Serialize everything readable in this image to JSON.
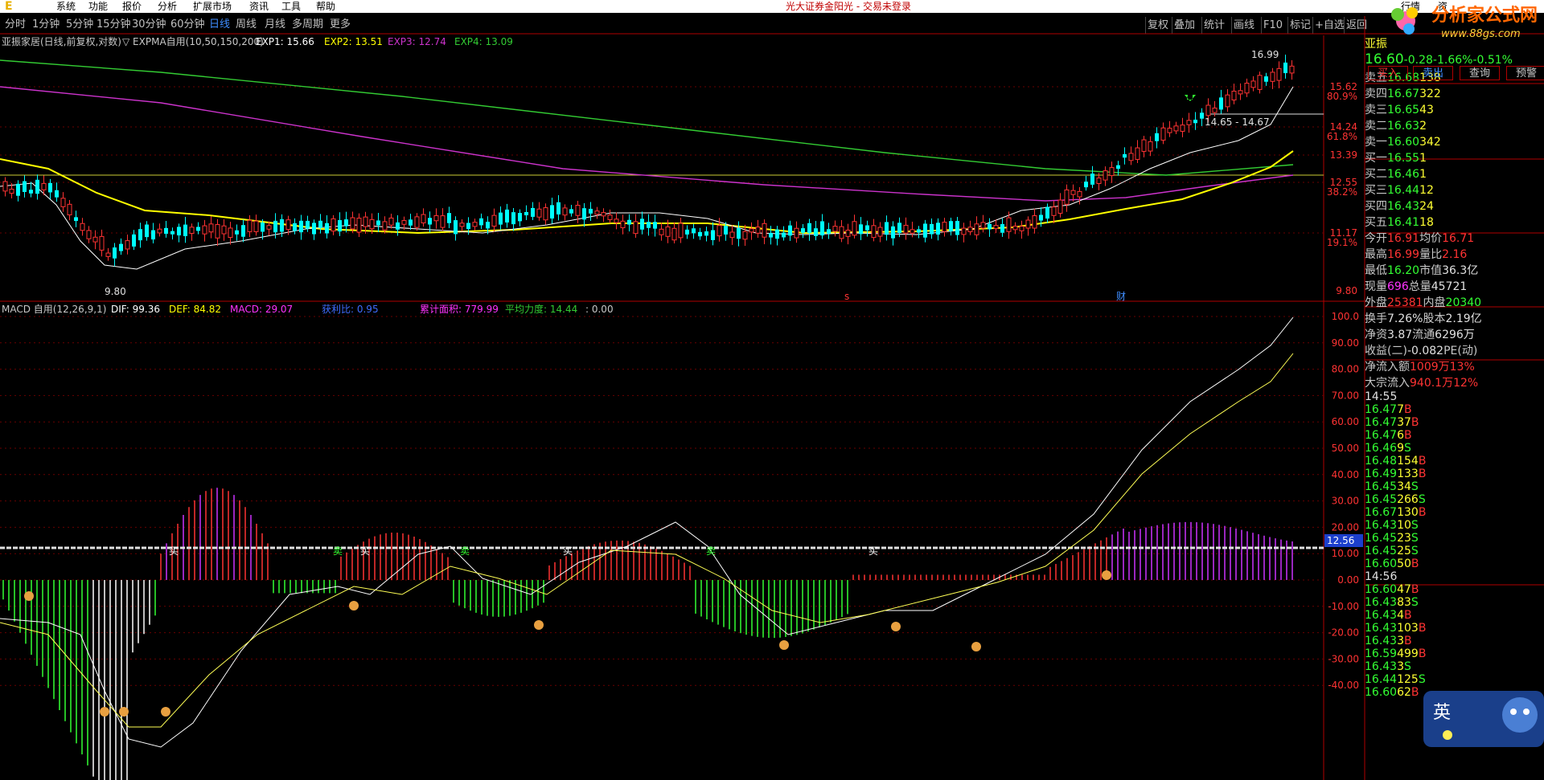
{
  "menubar": {
    "items": [
      "系统",
      "功能",
      "报价",
      "分析",
      "扩展市场",
      "资讯",
      "工具",
      "帮助"
    ],
    "broker": "光大证券金阳光 - 交易未登录",
    "right_items": [
      "行情",
      "资"
    ]
  },
  "toolbar": {
    "periods": [
      "分时",
      "1分钟",
      "5分钟",
      "15分钟",
      "30分钟",
      "60分钟",
      "日线",
      "周线",
      "月线",
      "多周期",
      "更多"
    ],
    "active_period": "日线",
    "buttons": [
      "复权",
      "叠加",
      "统计",
      "画线",
      "F10",
      "标记",
      "+自选",
      "返回"
    ]
  },
  "chart": {
    "title": "亚振家居(日线,前复权,对数)",
    "indicator": "EXPMA自用(10,50,150,200)",
    "exp1": "EXP1: 15.66",
    "exp2": "EXP2: 13.51",
    "exp3": "EXP3: 12.74",
    "exp4": "EXP4: 13.09",
    "colors": {
      "exp1": "#ffffff",
      "exp2": "#ffff00",
      "exp3": "#cc33cc",
      "exp4": "#33cc33",
      "up": "#ff3333",
      "down": "#00ffff"
    },
    "high_label": "16.99",
    "low_label": "9.80",
    "range_label": "14.65 - 14.67",
    "price_axis": [
      {
        "value": "15.62"
      },
      {
        "value": "80.9%"
      },
      {
        "value": "14.24"
      },
      {
        "value": "61.8%"
      },
      {
        "value": "13.39"
      },
      {
        "value": "12.55"
      },
      {
        "value": "38.2%"
      },
      {
        "value": "11.17"
      },
      {
        "value": "19.1%"
      },
      {
        "value": "9.80"
      }
    ],
    "markers": {
      "s": "s",
      "cai": "财"
    }
  },
  "macd": {
    "title": "MACD 自用(12,26,9,1)",
    "dif": "DIF: 99.36",
    "def": "DEF: 84.82",
    "macd": "MACD: 29.07",
    "profit": "获利比: 0.95",
    "area": "累计面积: 779.99",
    "force": "平均力度: 14.44",
    "extra": ": 0.00",
    "axis": [
      "100.0",
      "90.00",
      "80.00",
      "70.00",
      "60.00",
      "50.00",
      "40.00",
      "30.00",
      "20.00",
      "10.00",
      "0.00",
      "-10.00",
      "-20.00",
      "-30.00",
      "-40.00"
    ],
    "current": "12.56",
    "buy_label": "买",
    "sell_label": "卖"
  },
  "quote": {
    "name": "亚振",
    "price": "16.60",
    "change": "-0.28",
    "pct": "-1.66%",
    "pct2": "-0.51%",
    "actions": [
      "买入",
      "卖出",
      "查询",
      "预警"
    ],
    "asks": [
      {
        "label": "卖五",
        "price": "16.68",
        "vol": "138"
      },
      {
        "label": "卖四",
        "price": "16.67",
        "vol": "322"
      },
      {
        "label": "卖三",
        "price": "16.65",
        "vol": "43"
      },
      {
        "label": "卖二",
        "price": "16.63",
        "vol": "2"
      },
      {
        "label": "卖一",
        "price": "16.60",
        "vol": "342"
      }
    ],
    "bids": [
      {
        "label": "买一",
        "price": "16.55",
        "vol": "1"
      },
      {
        "label": "买二",
        "price": "16.46",
        "vol": "1"
      },
      {
        "label": "买三",
        "price": "16.44",
        "vol": "12"
      },
      {
        "label": "买四",
        "price": "16.43",
        "vol": "24"
      },
      {
        "label": "买五",
        "price": "16.41",
        "vol": "18"
      }
    ],
    "stats": [
      {
        "k1": "今开",
        "v1": "16.91",
        "k2": "均价",
        "v2": "16.71"
      },
      {
        "k1": "最高",
        "v1": "16.99",
        "k2": "量比",
        "v2": "2.16"
      },
      {
        "k1": "最低",
        "v1": "16.20",
        "k2": "市值",
        "v2": "36.3亿"
      },
      {
        "k1": "现量",
        "v1": "696",
        "k2": "总量",
        "v2": "45721"
      },
      {
        "k1": "外盘",
        "v1": "25381",
        "k2": "内盘",
        "v2": "20340"
      },
      {
        "k1": "换手",
        "v1": "7.26%",
        "k2": "股本",
        "v2": "2.19亿"
      },
      {
        "k1": "净资",
        "v1": "3.87",
        "k2": "流通",
        "v2": "6296万"
      },
      {
        "k1": "收益(二)",
        "v1": "-0.082",
        "k2": "PE(动)",
        "v2": ""
      }
    ],
    "flow": [
      {
        "k": "净流入额",
        "v": "1009万",
        "p": "13%"
      },
      {
        "k": "大宗流入",
        "v": "940.1万",
        "p": "12%"
      }
    ],
    "ticks1_time": "14:55",
    "ticks1": [
      {
        "p": "16.47",
        "v": "7",
        "s": "B"
      },
      {
        "p": "16.47",
        "v": "37",
        "s": "B"
      },
      {
        "p": "16.47",
        "v": "6",
        "s": "B"
      },
      {
        "p": "16.46",
        "v": "9",
        "s": "S"
      },
      {
        "p": "16.48",
        "v": "154",
        "s": "B"
      },
      {
        "p": "16.49",
        "v": "133",
        "s": "B"
      },
      {
        "p": "16.45",
        "v": "34",
        "s": "S"
      },
      {
        "p": "16.45",
        "v": "266",
        "s": "S"
      },
      {
        "p": "16.67",
        "v": "130",
        "s": "B"
      },
      {
        "p": "16.43",
        "v": "10",
        "s": "S"
      },
      {
        "p": "16.45",
        "v": "23",
        "s": "S"
      },
      {
        "p": "16.45",
        "v": "25",
        "s": "S"
      },
      {
        "p": "16.60",
        "v": "50",
        "s": "B"
      }
    ],
    "ticks2_time": "14:56",
    "ticks2": [
      {
        "p": "16.60",
        "v": "47",
        "s": "B"
      },
      {
        "p": "16.43",
        "v": "83",
        "s": "S"
      },
      {
        "p": "16.43",
        "v": "4",
        "s": "B"
      },
      {
        "p": "16.43",
        "v": "103",
        "s": "B"
      },
      {
        "p": "16.43",
        "v": "3",
        "s": "B"
      },
      {
        "p": "16.59",
        "v": "499",
        "s": "B"
      },
      {
        "p": "16.43",
        "v": "3",
        "s": "S"
      },
      {
        "p": "16.44",
        "v": "125",
        "s": "S"
      },
      {
        "p": "16.60",
        "v": "62",
        "s": "B"
      }
    ]
  },
  "logo": {
    "name": "分析家公式网",
    "url": "www.88gs.com"
  },
  "ime": "英"
}
